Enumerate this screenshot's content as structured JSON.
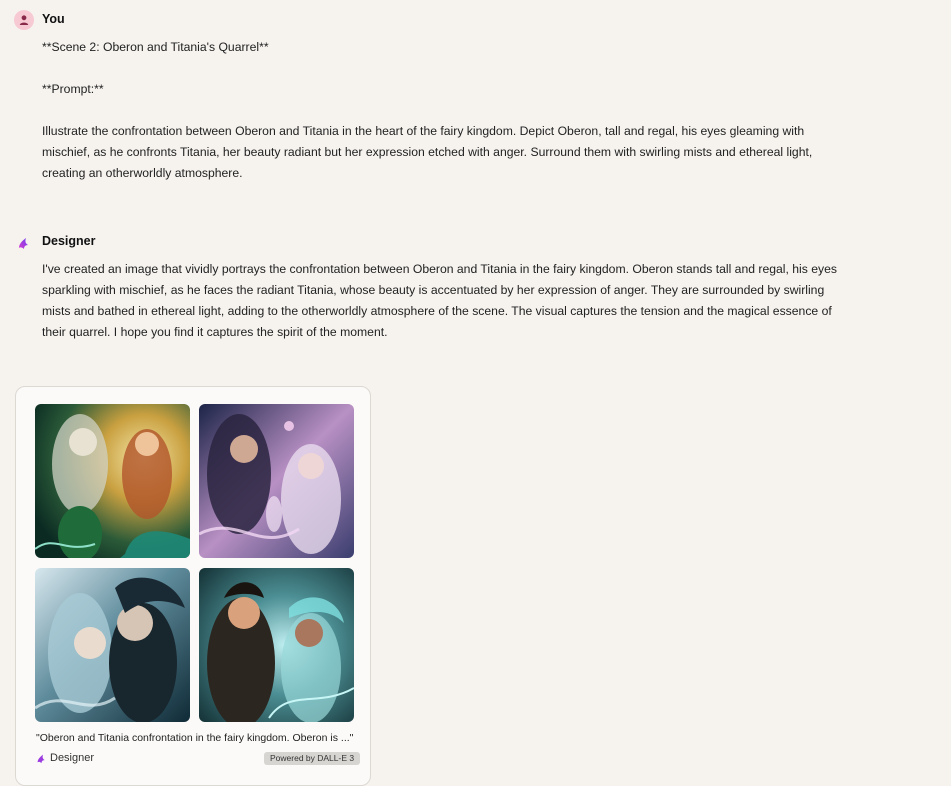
{
  "user_message": {
    "author": "You",
    "lines": [
      "**Scene 2: Oberon and Titania's Quarrel**",
      "**Prompt:**",
      "Illustrate the confrontation between Oberon and Titania in the heart of the fairy kingdom. Depict Oberon, tall and regal, his eyes gleaming with mischief, as he confronts Titania, her beauty radiant but her expression etched with anger. Surround them with swirling mists and ethereal light, creating an otherworldly atmosphere."
    ],
    "avatar_icon": "user-icon"
  },
  "assistant_message": {
    "author": "Designer",
    "text": "I've created an image that vividly portrays the confrontation between Oberon and Titania in the fairy kingdom. Oberon stands tall and regal, his eyes sparkling with mischief, as he faces the radiant Titania, whose beauty is accentuated by her expression of anger. They are surrounded by swirling mists and bathed in ethereal light, adding to the otherworldly atmosphere of the scene. The visual captures the tension and the magical essence of their quarrel. I hope you find it captures the spirit of the moment.",
    "avatar_icon": "designer-logo-icon"
  },
  "image_card": {
    "caption": "\"Oberon and Titania confrontation in the fairy kingdom. Oberon is ...\"",
    "brand_label": "Designer",
    "badge": "Powered by DALL-E 3",
    "images": [
      {
        "name": "generated-image-1",
        "palette": [
          "#0e3b2c",
          "#d7a046",
          "#e8d9a4",
          "#1e7a5c"
        ]
      },
      {
        "name": "generated-image-2",
        "palette": [
          "#2a2f55",
          "#c98fb3",
          "#e8d8ec",
          "#5a5f95"
        ]
      },
      {
        "name": "generated-image-3",
        "palette": [
          "#173c4a",
          "#9cc4d0",
          "#e4eef2",
          "#2b5c6c"
        ]
      },
      {
        "name": "generated-image-4",
        "palette": [
          "#143a3f",
          "#8fd0d0",
          "#d8a07c",
          "#2a5458"
        ]
      }
    ]
  },
  "colors": {
    "background": "#f6f3ef",
    "user_avatar_bg": "#f7c9d2",
    "user_avatar_fg": "#8a2a4a",
    "designer_accent": "#8a3cf0"
  }
}
